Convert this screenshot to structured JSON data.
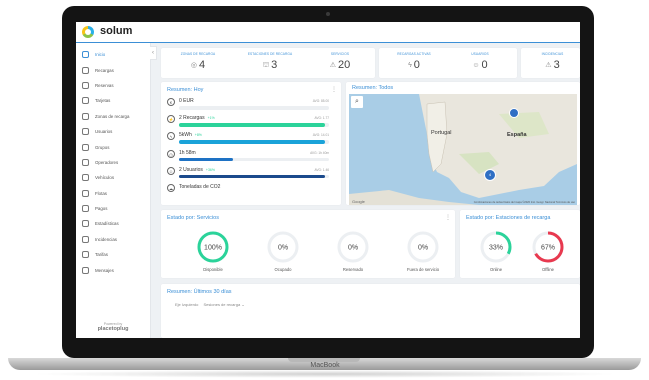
{
  "device": {
    "brand": "MacBook"
  },
  "app": {
    "name": "solum"
  },
  "sidebar": {
    "items": [
      {
        "label": "Inicio",
        "icon": "home-icon",
        "active": true
      },
      {
        "label": "Recargas",
        "icon": "bolt-icon"
      },
      {
        "label": "Reservas",
        "icon": "calendar-icon"
      },
      {
        "label": "Tarjetas",
        "icon": "card-icon"
      },
      {
        "label": "Zonas de recarga",
        "icon": "location-icon"
      },
      {
        "label": "Usuarios",
        "icon": "user-icon"
      },
      {
        "label": "Grupos",
        "icon": "group-icon"
      },
      {
        "label": "Operadores",
        "icon": "operator-icon"
      },
      {
        "label": "Vehículos",
        "icon": "car-icon"
      },
      {
        "label": "Flotas",
        "icon": "fleet-icon"
      },
      {
        "label": "Pagos",
        "icon": "payment-icon"
      },
      {
        "label": "Estadísticas",
        "icon": "stats-icon"
      },
      {
        "label": "Incidencias",
        "icon": "alert-icon"
      },
      {
        "label": "Tarifas",
        "icon": "tariff-icon"
      },
      {
        "label": "Mensajes",
        "icon": "message-icon"
      }
    ],
    "powered_by": "Powered by",
    "powered_brand": "placetoplug"
  },
  "stats": [
    {
      "label": "ZONAS DE RECARGA",
      "value": "4",
      "icon": "location-icon"
    },
    {
      "label": "ESTACIONES DE RECARGA",
      "value": "3",
      "icon": "station-icon"
    },
    {
      "label": "SERVICIOS",
      "value": "20",
      "icon": "service-icon"
    },
    {
      "label": "RECARGAS ACTIVAS",
      "value": "0",
      "icon": "bolt-icon"
    },
    {
      "label": "USUARIOS",
      "value": "0",
      "icon": "user-icon"
    },
    {
      "label": "INCIDENCIAS",
      "value": "3",
      "icon": "alert-icon"
    }
  ],
  "summary_today": {
    "title": "Resumen: Hoy",
    "rows": [
      {
        "value": "0 EUR",
        "delta": "",
        "avg": "AVG: 85.00",
        "fraction": 0.0,
        "color": "#c8cdd3"
      },
      {
        "value": "2 Recargas",
        "delta": "+1%",
        "avg": "AVG: 1.77",
        "fraction": 0.97,
        "color": "#2bd39a"
      },
      {
        "value": "5kWh",
        "delta": "+8%",
        "avg": "AVG: 14.01",
        "fraction": 0.97,
        "color": "#1aa3d9"
      },
      {
        "value": "1h 58m",
        "delta": "",
        "avg": "AVG: 1h 40m",
        "fraction": 0.36,
        "color": "#1e72c4"
      },
      {
        "value": "2 Usuarios",
        "delta": "+36%",
        "avg": "AVG: 1.46",
        "fraction": 0.97,
        "color": "#1b4a8c"
      },
      {
        "value": "Toneladas de CO2",
        "delta": "",
        "avg": "",
        "fraction": 0.0,
        "color": "#c8cdd3"
      }
    ]
  },
  "summary_all": {
    "title": "Resumen: Todos",
    "map_labels": {
      "portugal": "Portugal",
      "spain": "España"
    },
    "cluster_count": "4",
    "credit": "Combinaciones de teclas   Datos del mapa ©2020 Inst. Geogr. Nacional   Términos de uso",
    "google": "Google"
  },
  "status_services": {
    "title": "Estado por: Servicios",
    "items": [
      {
        "label": "Disponible",
        "value": "100%",
        "fraction": 1.0,
        "color": "#2bd39a"
      },
      {
        "label": "Ocupado",
        "value": "0%",
        "fraction": 0.0,
        "color": "#2bd39a"
      },
      {
        "label": "Reservado",
        "value": "0%",
        "fraction": 0.0,
        "color": "#2bd39a"
      },
      {
        "label": "Fuera de servicio",
        "value": "0%",
        "fraction": 0.0,
        "color": "#2bd39a"
      }
    ]
  },
  "status_stations": {
    "title": "Estado por: Estaciones de recarga",
    "items": [
      {
        "label": "Online",
        "value": "33%",
        "fraction": 0.33,
        "color": "#2bd39a"
      },
      {
        "label": "Offline",
        "value": "67%",
        "fraction": 0.67,
        "color": "#e8394f"
      }
    ]
  },
  "summary_30": {
    "title": "Resumen: Últimos 30 días",
    "filter_label": "Eje Izquierdo",
    "filter_value": "Sesiones de recarga"
  }
}
